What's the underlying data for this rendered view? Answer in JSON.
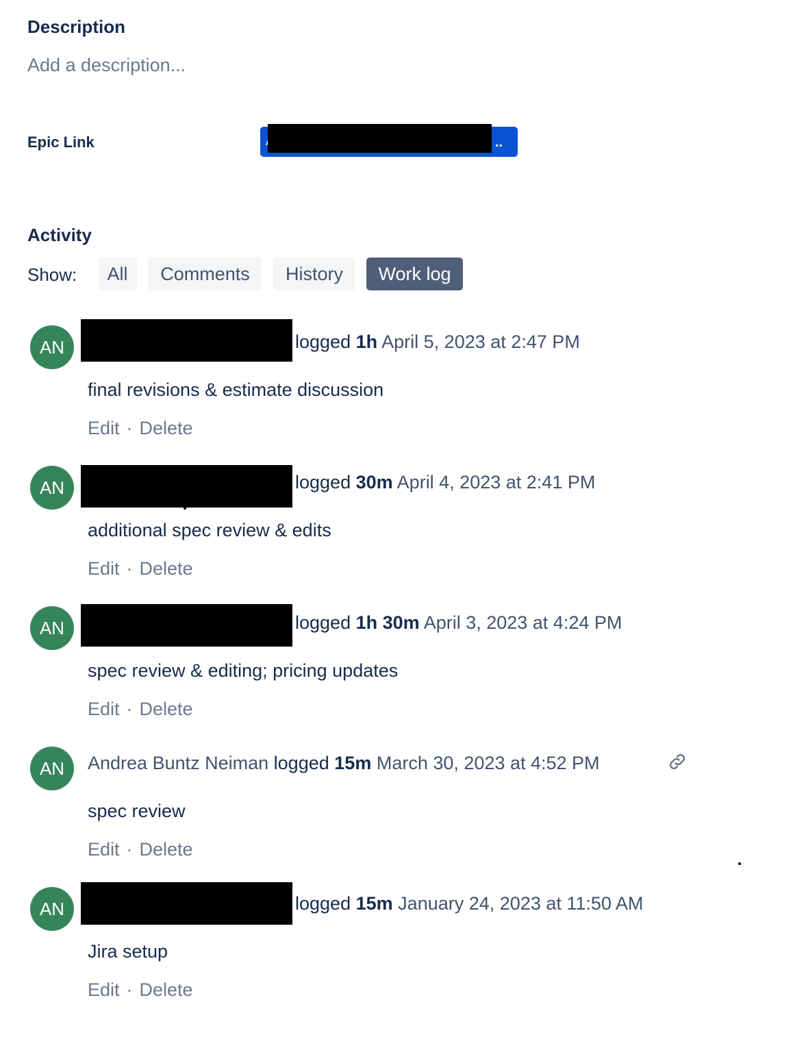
{
  "description": {
    "title": "Description",
    "placeholder": "Add a description..."
  },
  "epic_link": {
    "label": "Epic Link",
    "value_prefix": "A",
    "value_suffix": ".."
  },
  "activity": {
    "title": "Activity",
    "show_label": "Show:",
    "filters": [
      {
        "label": "All",
        "active": false
      },
      {
        "label": "Comments",
        "active": false
      },
      {
        "label": "History",
        "active": false
      },
      {
        "label": "Work log",
        "active": true
      }
    ]
  },
  "worklog": [
    {
      "initials": "AN",
      "author": "",
      "logged": "logged",
      "duration": "1h",
      "date": "April 5, 2023 at 2:47 PM",
      "comment": "final revisions & estimate discussion",
      "edit": "Edit",
      "separator": "·",
      "delete": "Delete"
    },
    {
      "initials": "AN",
      "author": "",
      "logged": "logged",
      "duration": "30m",
      "date": "April 4, 2023 at 2:41 PM",
      "comment": "additional spec review & edits",
      "edit": "Edit",
      "separator": "·",
      "delete": "Delete"
    },
    {
      "initials": "AN",
      "author": "",
      "logged": "logged",
      "duration": "1h 30m",
      "date": "April 3, 2023 at 4:24 PM",
      "comment": "spec review & editing; pricing updates",
      "edit": "Edit",
      "separator": "·",
      "delete": "Delete"
    },
    {
      "initials": "AN",
      "author": "Andrea Buntz Neiman",
      "logged": "logged",
      "duration": "15m",
      "date": "March 30, 2023 at 4:52 PM",
      "comment": "spec review",
      "edit": "Edit",
      "separator": "·",
      "delete": "Delete",
      "icon": "link-icon"
    },
    {
      "initials": "AN",
      "author": "",
      "logged": "logged",
      "duration": "15m",
      "date": "January 24, 2023 at 11:50 AM",
      "comment": "Jira setup",
      "edit": "Edit",
      "separator": "·",
      "delete": "Delete"
    }
  ],
  "colors": {
    "avatar": "#36855a",
    "epic": "#0c52d4",
    "active_filter": "#505f79"
  }
}
